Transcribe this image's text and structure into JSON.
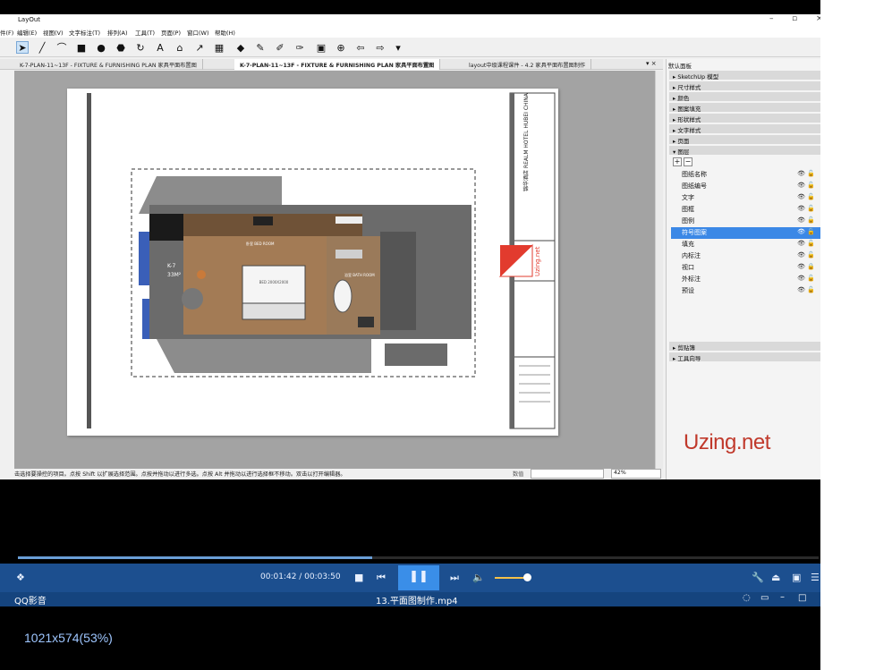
{
  "app": {
    "title": "LayOut",
    "menu": [
      "件(F)",
      "编辑(E)",
      "视图(V)",
      "文字标注(T)",
      "排列(A)",
      "工具(T)",
      "页面(P)",
      "窗口(W)",
      "帮助(H)"
    ],
    "tabs": [
      "K-7-PLAN-11~13F - FIXTURE & FURNISHING PLAN 家具平面布置图",
      "K-7-PLAN-11~13F - FIXTURE & FURNISHING PLAN 家具平面布置图",
      "layout中级课程课件 - 4.2 家具平面布置图制作"
    ],
    "status_message": "击选择要操控的项目。点按 Shift 以扩展选择范围。点按并拖动以进行多选。点按 Alt 并拖动以进行选择框不移动。双击以打开编辑器。",
    "measure_label": "数值",
    "zoom": "42%"
  },
  "drawing": {
    "room_tag": "K-7",
    "area": "33M²",
    "bedroom": "卧室\nBED ROOM",
    "bathroom": "浴室\nBATH ROOM",
    "bed_label": "BED 2000X2000",
    "titleblock_name": "锦华酒店\nREALM HOTEL\nHUBEI CHINA",
    "titleblock_logo": "Uzing.net"
  },
  "panel": {
    "title": "默认面板",
    "sections_top": [
      "SketchUp 模型",
      "尺寸样式",
      "颜色",
      "图案填充",
      "形状样式",
      "文字样式",
      "页面"
    ],
    "layers_header": "图层",
    "layers": [
      "图纸名称",
      "图纸编号",
      "文字",
      "图框",
      "图例",
      "符号图案",
      "填充",
      "内标注",
      "视口",
      "外标注",
      "预设"
    ],
    "active_layer": "符号图案",
    "sections_bottom": [
      "剪贴簿",
      "工具向导"
    ]
  },
  "watermark": "Uzing.net",
  "player": {
    "time": "00:01:42 / 00:03:50",
    "brand": "QQ影音",
    "filename": "13.平面图制作.mp4",
    "resolution": "1021x574(53%)",
    "progress": 0.443
  },
  "colors": {
    "accent": "#3b88e6",
    "player_blue": "#1c4f8f",
    "brand_red": "#c0392b"
  }
}
